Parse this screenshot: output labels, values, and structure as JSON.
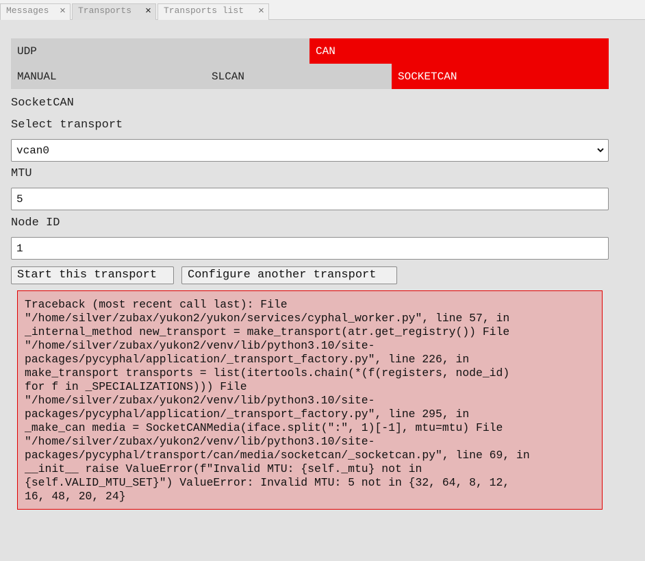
{
  "tabs": [
    {
      "label": "Messages",
      "close": "×"
    },
    {
      "label": "Transports",
      "close": "×"
    },
    {
      "label": "Transports list",
      "close": "×"
    }
  ],
  "transport_types": {
    "udp": "UDP",
    "can": "CAN",
    "selected": "CAN"
  },
  "can_modes": {
    "manual": "MANUAL",
    "slcan": "SLCAN",
    "socketcan": "SOCKETCAN",
    "selected": "SOCKETCAN"
  },
  "section_title": "SocketCAN",
  "select_transport": {
    "label": "Select transport",
    "value": "vcan0"
  },
  "mtu": {
    "label": "MTU",
    "value": "5"
  },
  "node_id": {
    "label": "Node ID",
    "value": "1"
  },
  "buttons": {
    "start": "Start this transport",
    "configure": "Configure another transport"
  },
  "error_text": "Traceback (most recent call last): File\n\"/home/silver/zubax/yukon2/yukon/services/cyphal_worker.py\", line 57, in\n_internal_method new_transport = make_transport(atr.get_registry()) File\n\"/home/silver/zubax/yukon2/venv/lib/python3.10/site-\npackages/pycyphal/application/_transport_factory.py\", line 226, in\nmake_transport transports = list(itertools.chain(*(f(registers, node_id)\nfor f in _SPECIALIZATIONS))) File\n\"/home/silver/zubax/yukon2/venv/lib/python3.10/site-\npackages/pycyphal/application/_transport_factory.py\", line 295, in\n_make_can media = SocketCANMedia(iface.split(\":\", 1)[-1], mtu=mtu) File\n\"/home/silver/zubax/yukon2/venv/lib/python3.10/site-\npackages/pycyphal/transport/can/media/socketcan/_socketcan.py\", line 69, in\n__init__ raise ValueError(f\"Invalid MTU: {self._mtu} not in\n{self.VALID_MTU_SET}\") ValueError: Invalid MTU: 5 not in {32, 64, 8, 12,\n16, 48, 20, 24}",
  "colors": {
    "accent_red": "#ee0000",
    "segment_gray": "#cfcfcf",
    "error_bg": "#e6b8b8"
  },
  "icons": {
    "tab_close": "close-icon",
    "select_arrow": "chevron-down-icon"
  }
}
